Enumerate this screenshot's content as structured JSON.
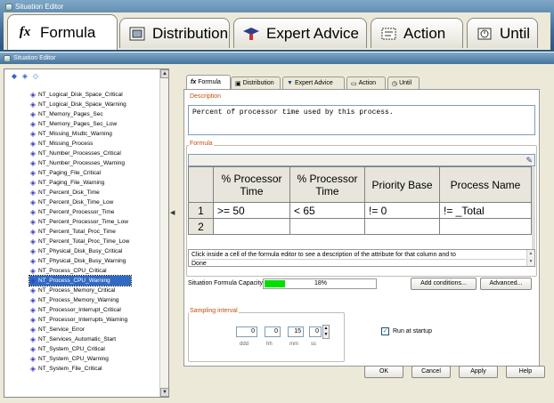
{
  "big_window": {
    "title": "Situation Editor",
    "tabs": [
      {
        "label": "Formula",
        "icon": "fx-icon"
      },
      {
        "label": "Distribution",
        "icon": "distribution-icon"
      },
      {
        "label": "Expert Advice",
        "icon": "graduation-cap-icon"
      },
      {
        "label": "Action",
        "icon": "action-icon"
      },
      {
        "label": "Until",
        "icon": "until-icon"
      }
    ]
  },
  "window": {
    "title": "Situation Editor",
    "tree_items": [
      "NT_Logical_Disk_Space_Critical",
      "NT_Logical_Disk_Space_Warning",
      "NT_Memory_Pages_Sec",
      "NT_Memory_Pages_Sec_Low",
      "NT_Missing_Msdtc_Warning",
      "NT_Missing_Process",
      "NT_Number_Processes_Critical",
      "NT_Number_Processes_Warning",
      "NT_Paging_File_Critical",
      "NT_Paging_File_Warning",
      "NT_Percent_Disk_Time",
      "NT_Percent_Disk_Time_Low",
      "NT_Percent_Processor_Time",
      "NT_Percent_Processor_Time_Low",
      "NT_Percent_Total_Proc_Time",
      "NT_Percent_Total_Proc_Time_Low",
      "NT_Physical_Disk_Busy_Critical",
      "NT_Physical_Disk_Busy_Warning",
      "NT_Process_CPU_Critical",
      "NT_Process_CPU_Warning",
      "NT_Process_Memory_Critical",
      "NT_Process_Memory_Warning",
      "NT_Processor_Interrupt_Critical",
      "NT_Processor_Interrupts_Warning",
      "NT_Service_Error",
      "NT_Services_Automatic_Start",
      "NT_System_CPU_Critical",
      "NT_System_CPU_Warning",
      "NT_System_File_Critical"
    ],
    "selected_tree_item": "NT_Process_CPU_Warning",
    "tabs": [
      "Formula",
      "Distribution",
      "Expert Advice",
      "Action",
      "Until"
    ],
    "description_label": "Description",
    "description_value": "Percent of processor time used by this process.",
    "formula_label": "Formula",
    "formula_columns": [
      "% Processor Time",
      "% Processor Time",
      "Priority Base",
      "Process Name"
    ],
    "formula_rows": [
      {
        "num": "1",
        "cells": [
          ">= 50",
          "< 65",
          "!= 0",
          "!= _Total"
        ]
      },
      {
        "num": "2",
        "cells": [
          "",
          "",
          "",
          ""
        ]
      }
    ],
    "hint_text": "Click inside a cell of the formula editor to see a description of the attribute for that column and to",
    "hint_status": "Done",
    "capacity_label": "Situation Formula Capacity",
    "capacity_value": "18%",
    "capacity_fraction": 0.18,
    "add_conditions_button": "Add conditions...",
    "advanced_button": "Advanced...",
    "sampling_label": "Sampling interval",
    "sampling_values": [
      "0",
      "0",
      "15",
      "0"
    ],
    "sampling_units": [
      "ddd",
      "hh",
      "mm",
      "ss"
    ],
    "run_at_startup_label": "Run at startup",
    "run_at_startup_checked": true,
    "buttons": {
      "ok": "OK",
      "cancel": "Cancel",
      "apply": "Apply",
      "help": "Help"
    }
  }
}
